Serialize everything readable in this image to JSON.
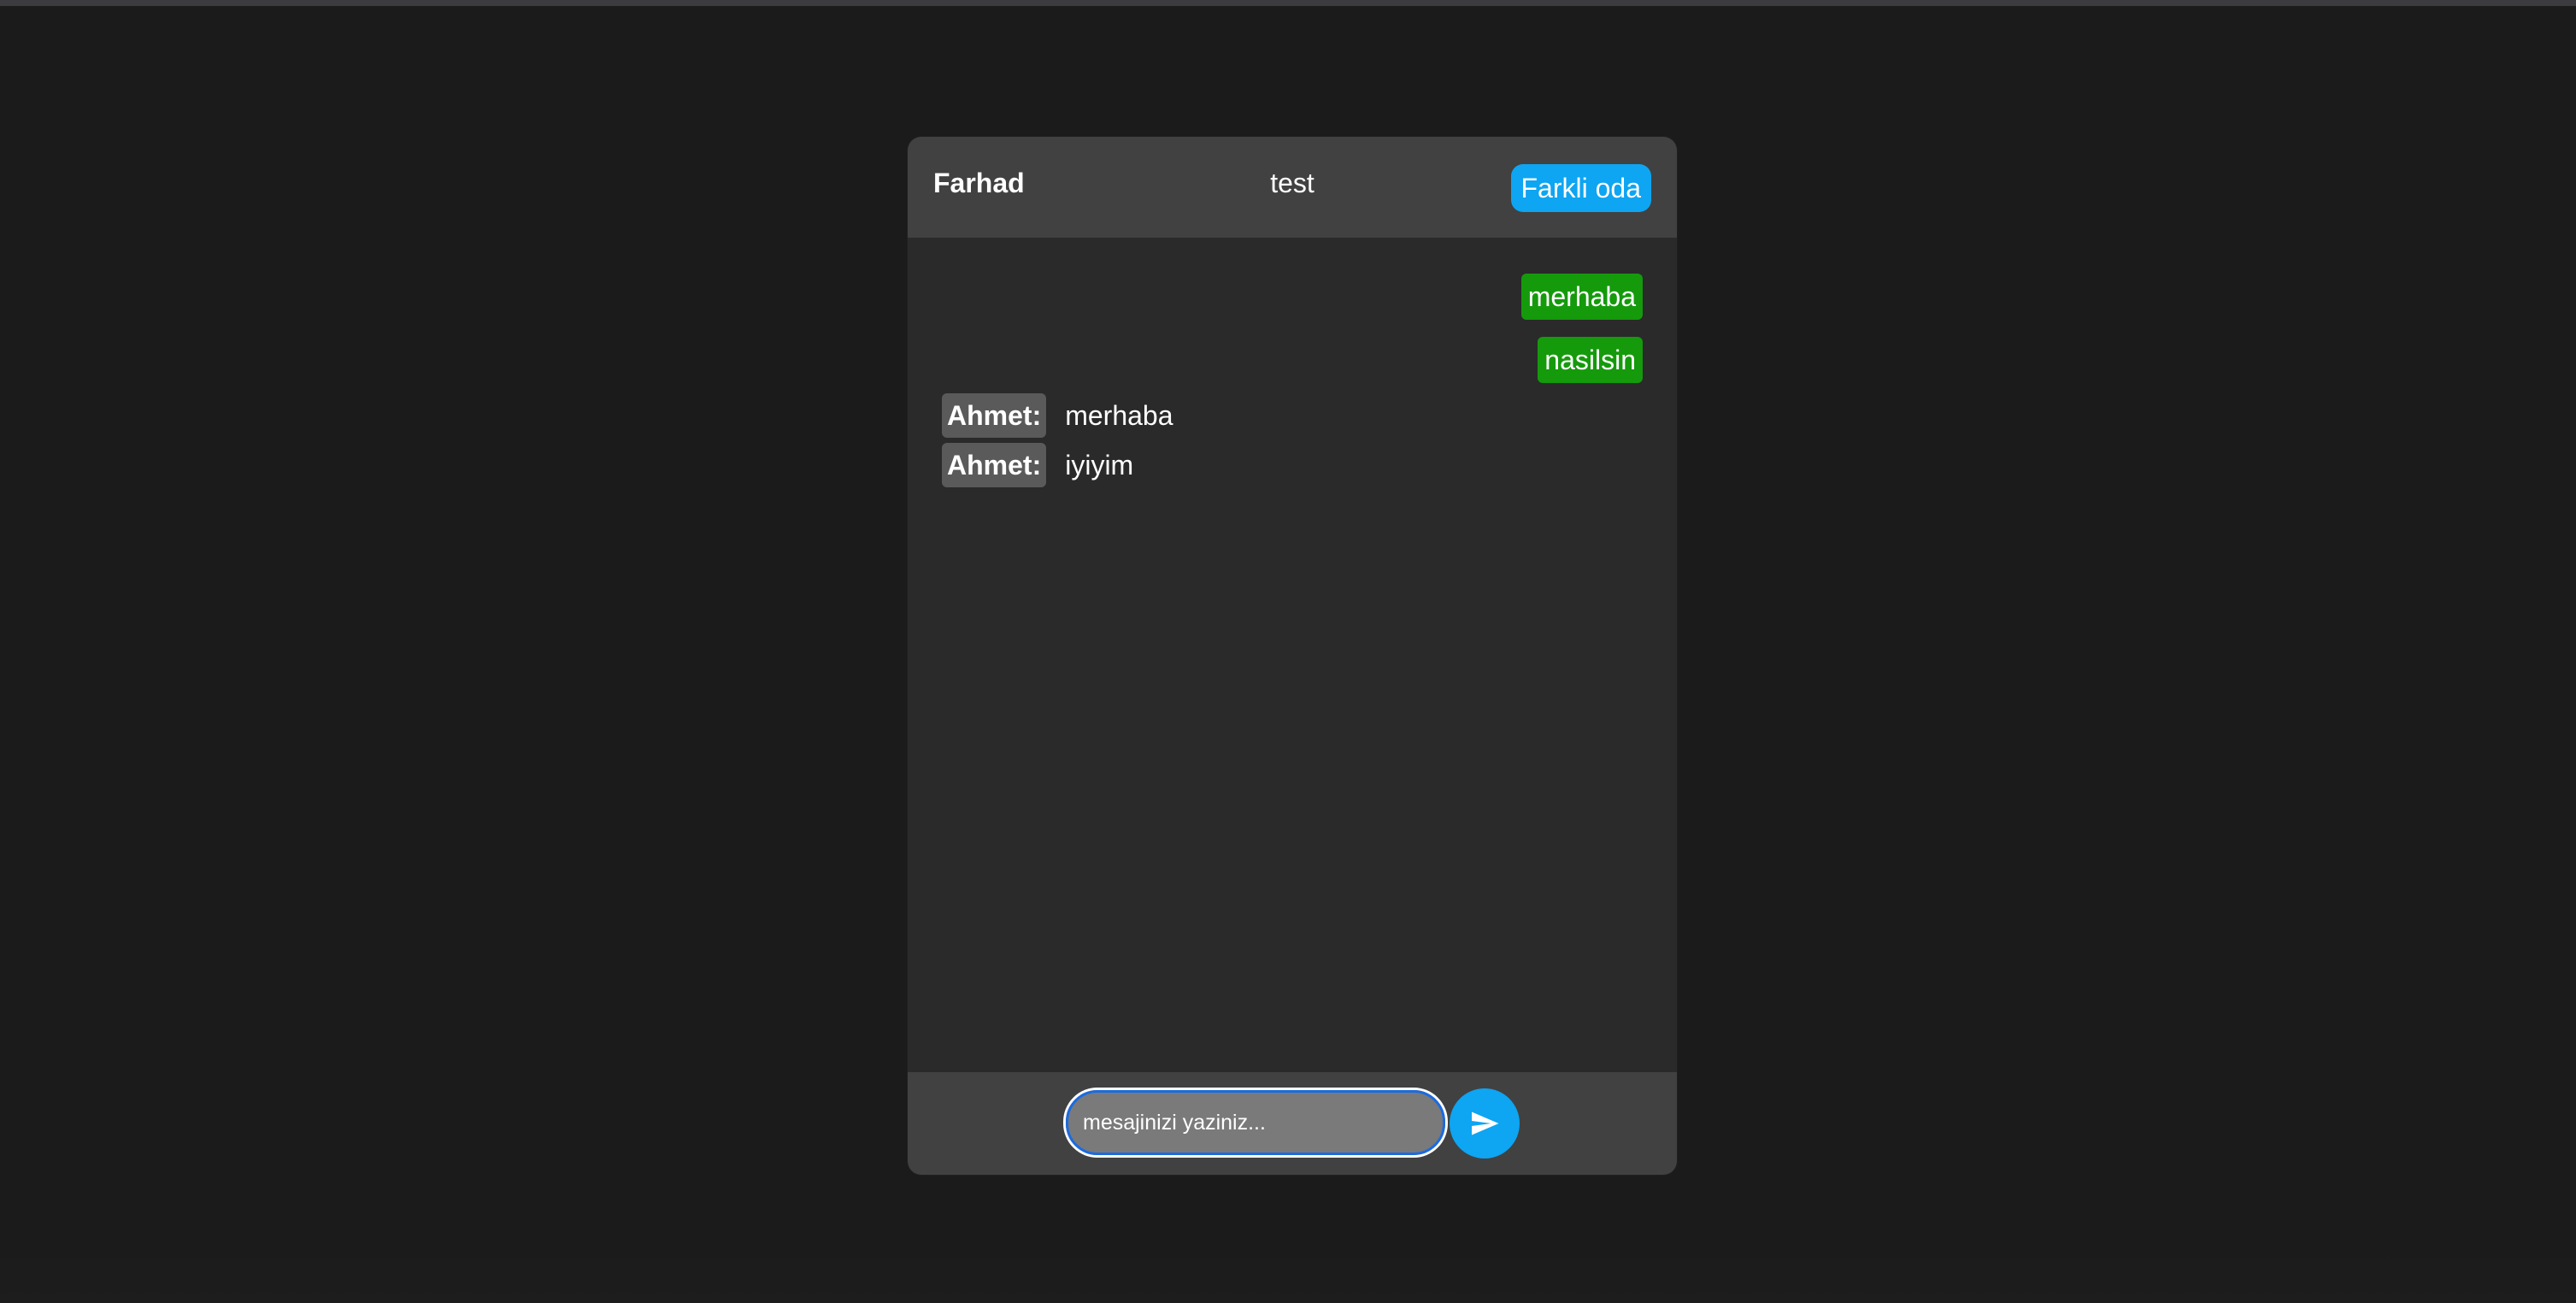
{
  "header": {
    "username": "Farhad",
    "room": "test",
    "change_room_label": "Farkli oda"
  },
  "messages": {
    "own": [
      {
        "text": "merhaba"
      },
      {
        "text": "nasilsin"
      }
    ],
    "others": [
      {
        "sender": "Ahmet:",
        "text": "merhaba"
      },
      {
        "sender": "Ahmet:",
        "text": "iyiyim"
      }
    ]
  },
  "composer": {
    "placeholder": "mesajinizi yaziniz...",
    "value": "",
    "send_icon": "send-icon"
  },
  "colors": {
    "page_bg": "#1b1b1b",
    "panel_bg": "#2a2a2a",
    "header_bg": "#414141",
    "accent": "#0ea5f2",
    "own_bubble": "#159a0c",
    "sender_badge": "#5a5a5a"
  }
}
